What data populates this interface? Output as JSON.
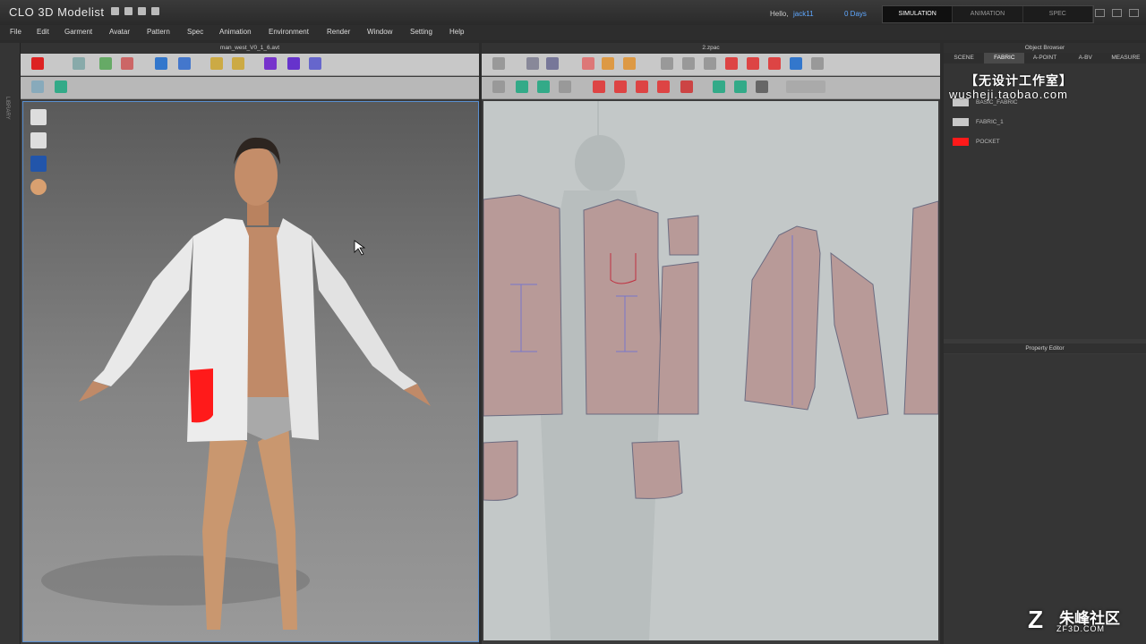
{
  "app": {
    "title": "3D Modelist",
    "logo_prefix": "CLO"
  },
  "header": {
    "hello": "Hello,",
    "user": "jack11",
    "days": "0 Days"
  },
  "modes": [
    "SIMULATION",
    "ANIMATION",
    "SPEC"
  ],
  "menu": [
    "File",
    "Edit",
    "Garment",
    "Avatar",
    "Pattern",
    "Spec",
    "Animation",
    "Environment",
    "Render",
    "Window",
    "Setting",
    "Help"
  ],
  "library_label": "LIBRARY",
  "view3d": {
    "title": "man_west_V0_1_6.avt"
  },
  "view2d": {
    "title": "2.zpac"
  },
  "object_browser": {
    "title": "Object Browser",
    "tabs": [
      "SCENE",
      "FABRIC",
      "A-POINT",
      "A-BV",
      "MEASURE"
    ],
    "fabrics": [
      {
        "name": "BASIC_FABRIC",
        "color": "#c8c8c8"
      },
      {
        "name": "FABRIC_1",
        "color": "#c8c8c8"
      },
      {
        "name": "POCKET",
        "color": "#ff1a1a"
      }
    ]
  },
  "property_editor": {
    "title": "Property Editor"
  },
  "watermarks": {
    "studio_cn": "【无设计工作室】",
    "studio_url": "wusheji.taobao.com",
    "site_mark": "Z",
    "site_cn": "朱峰社区",
    "site_url": "ZF3D.COM"
  },
  "colors": {
    "accent": "#5fa8ff",
    "pocket": "#ff1a1a",
    "pattern_fill": "#b89a98"
  }
}
